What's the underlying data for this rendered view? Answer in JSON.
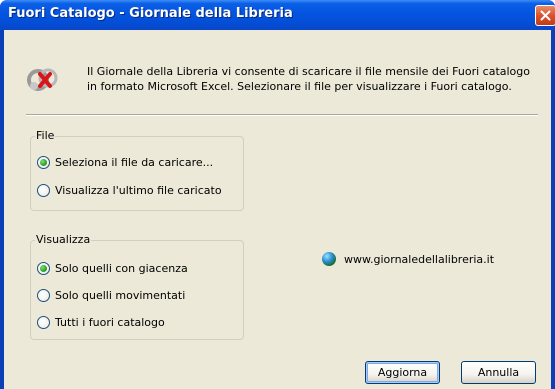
{
  "window": {
    "title": "Fuori Catalogo - Giornale della Libreria"
  },
  "intro": {
    "line1": "Il Giornale della Libreria vi consente di scaricare il file mensile dei Fuori catalogo",
    "line2": "in formato Microsoft Excel. Selezionare il file per visualizzare i Fuori catalogo."
  },
  "file_group": {
    "legend": "File",
    "options": [
      {
        "label": "Seleziona il file da caricare...",
        "checked": true
      },
      {
        "label": "Visualizza l'ultimo file caricato",
        "checked": false
      }
    ]
  },
  "visualizza_group": {
    "legend": "Visualizza",
    "options": [
      {
        "label": "Solo quelli con giacenza",
        "checked": true
      },
      {
        "label": "Solo quelli movimentati",
        "checked": false
      },
      {
        "label": "Tutti i fuori catalogo",
        "checked": false
      }
    ]
  },
  "link": {
    "text": "www.giornaledellalibreria.it",
    "icon": "globe-icon"
  },
  "buttons": {
    "ok_label": "Aggiorna",
    "cancel_label": "Annulla"
  },
  "colors": {
    "titlebar": "#0454e0",
    "client_background": "#ece9d8",
    "close_button": "#d9532d",
    "radio_checked": "#2fa82a"
  }
}
